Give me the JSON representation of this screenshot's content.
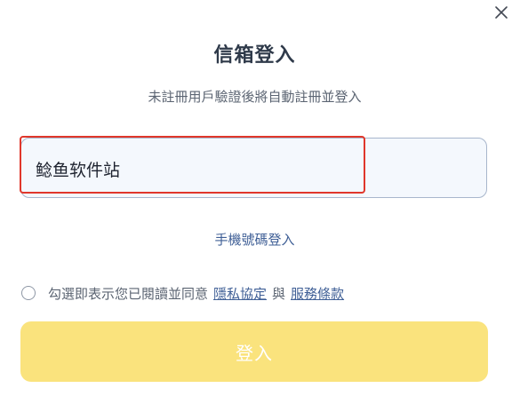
{
  "dialog": {
    "close_icon": "close-icon",
    "title": "信箱登入",
    "subtitle": "未註冊用戶驗證後將自動註冊並登入"
  },
  "email": {
    "value": "鲶鱼软件站",
    "highlight_color": "#e0372b"
  },
  "phone_login_label": "手機號碼登入",
  "agreement": {
    "text": "勾選即表示您已閱讀並同意",
    "privacy_label": "隱私協定",
    "joiner": "與",
    "terms_label": "服務條款"
  },
  "login_button_label": "登入",
  "colors": {
    "button": "#fae37d",
    "link": "#3f5f96",
    "title": "#2f3a4a"
  }
}
